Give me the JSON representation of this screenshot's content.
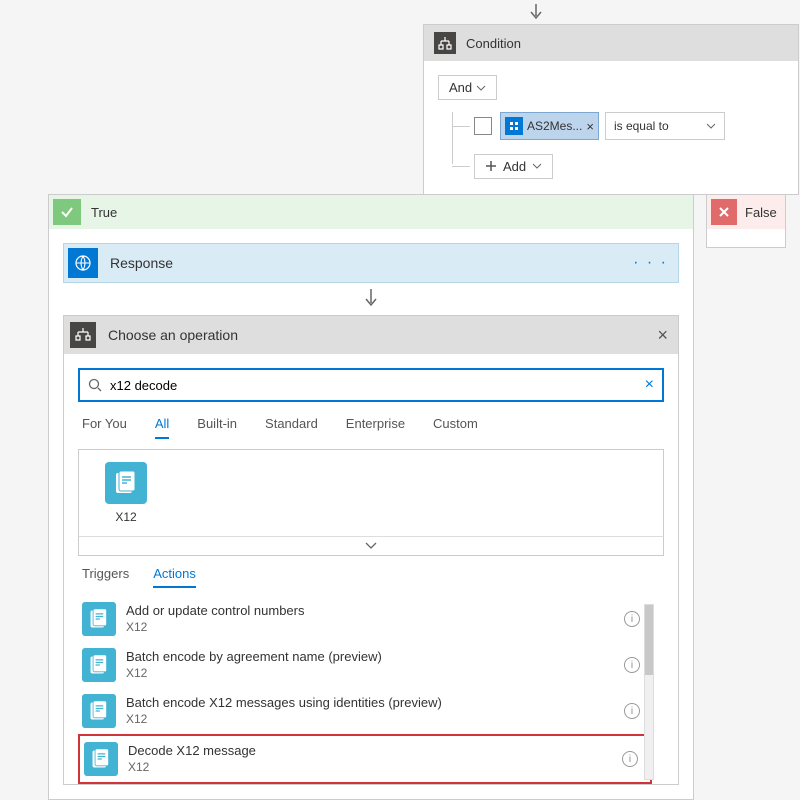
{
  "condition": {
    "title": "Condition",
    "rootOperator": "And",
    "row": {
      "tokenLabel": "AS2Mes...",
      "operator": "is equal to"
    },
    "addLabel": "Add"
  },
  "branches": {
    "trueLabel": "True",
    "falseLabel": "False"
  },
  "response": {
    "title": "Response"
  },
  "picker": {
    "title": "Choose an operation",
    "searchValue": "x12 decode",
    "filters": [
      "For You",
      "All",
      "Built-in",
      "Standard",
      "Enterprise",
      "Custom"
    ],
    "activeFilter": "All",
    "connector": {
      "name": "X12"
    },
    "subTabs": [
      "Triggers",
      "Actions"
    ],
    "activeSubTab": "Actions",
    "actions": [
      {
        "title": "Add or update control numbers",
        "subtitle": "X12",
        "highlight": false
      },
      {
        "title": "Batch encode by agreement name (preview)",
        "subtitle": "X12",
        "highlight": false
      },
      {
        "title": "Batch encode X12 messages using identities (preview)",
        "subtitle": "X12",
        "highlight": false
      },
      {
        "title": "Decode X12 message",
        "subtitle": "X12",
        "highlight": true
      }
    ]
  }
}
